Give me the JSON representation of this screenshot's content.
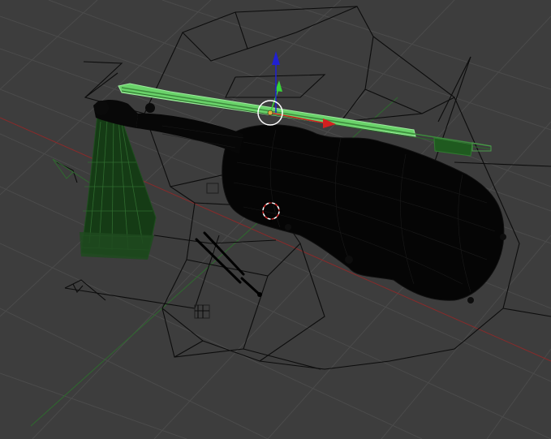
{
  "viewport": {
    "view": "3d-viewport",
    "shading": "wireframe",
    "background_color": "#3d3d3d",
    "grid_color": "#4a4a4a",
    "x_axis_color": "#8a2a2a",
    "y_axis_color": "#2e6a2e"
  },
  "objects": [
    {
      "name": "violin-body",
      "selected": false,
      "color": "#000000"
    },
    {
      "name": "violin-bow",
      "selected": true,
      "color": "#6ad36a"
    },
    {
      "name": "metronome",
      "selected": false,
      "color": "#1f4f1f"
    },
    {
      "name": "tuning-fork",
      "selected": false,
      "color": "#000000"
    },
    {
      "name": "environment-mesh",
      "selected": false,
      "color": "#000000"
    }
  ],
  "gizmo": {
    "type": "translate",
    "x_color": "#d32020",
    "y_color": "#3ad33a",
    "z_color": "#2020d3"
  },
  "cursor_3d": {
    "color_a": "#d82c2c",
    "color_b": "#ffffff"
  }
}
